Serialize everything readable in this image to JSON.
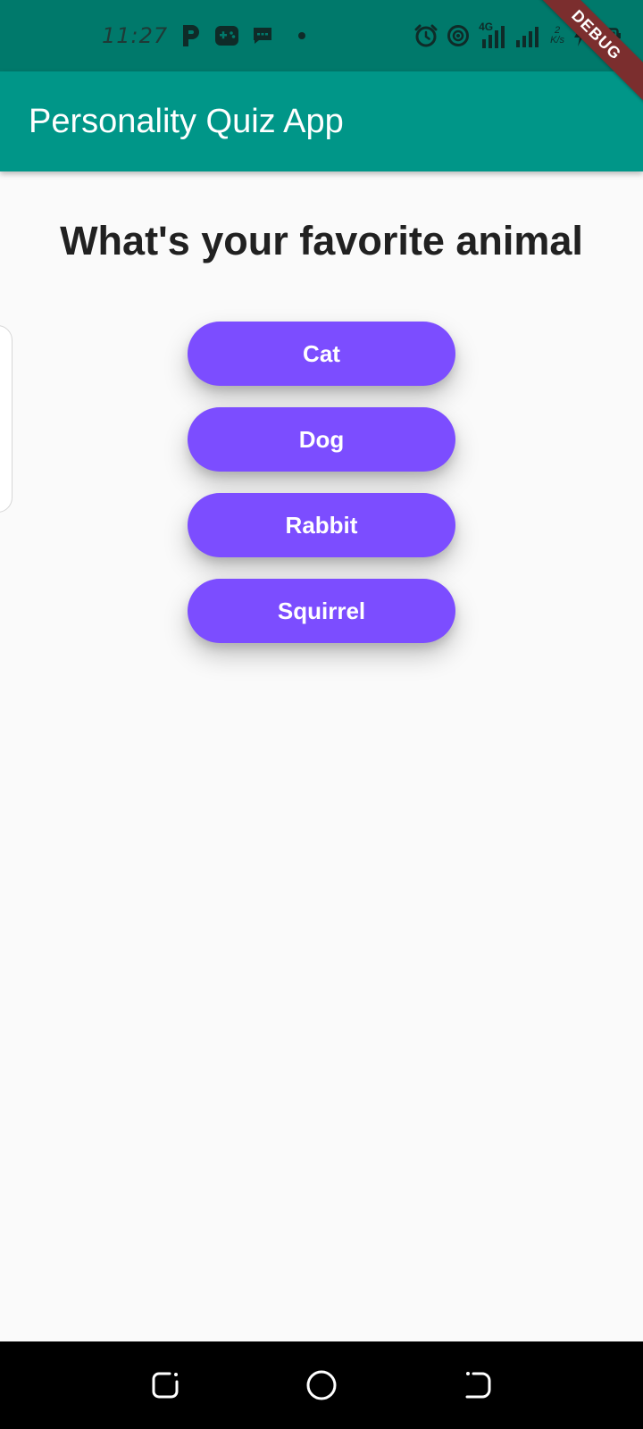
{
  "status_bar": {
    "time": "11:27",
    "network_label": "4G",
    "icons": [
      "p-app-icon",
      "game-controller-icon",
      "message-icon",
      "dot-icon",
      "alarm-icon",
      "hotspot-icon",
      "signal-4g-icon",
      "signal-icon",
      "speed-indicator",
      "charging-icon",
      "battery-icon"
    ],
    "speed_top": "2",
    "speed_bottom": "K/s"
  },
  "debug_banner": "DEBUG",
  "app_bar": {
    "title": "Personality Quiz App",
    "color": "#009688"
  },
  "quiz": {
    "question": "What's your favorite animal",
    "answers": [
      {
        "label": "Cat"
      },
      {
        "label": "Dog"
      },
      {
        "label": "Rabbit"
      },
      {
        "label": "Squirrel"
      }
    ],
    "button_color": "#7c4dff"
  },
  "nav_bar": {
    "buttons": [
      "recent-apps-icon",
      "home-icon",
      "back-icon"
    ]
  }
}
